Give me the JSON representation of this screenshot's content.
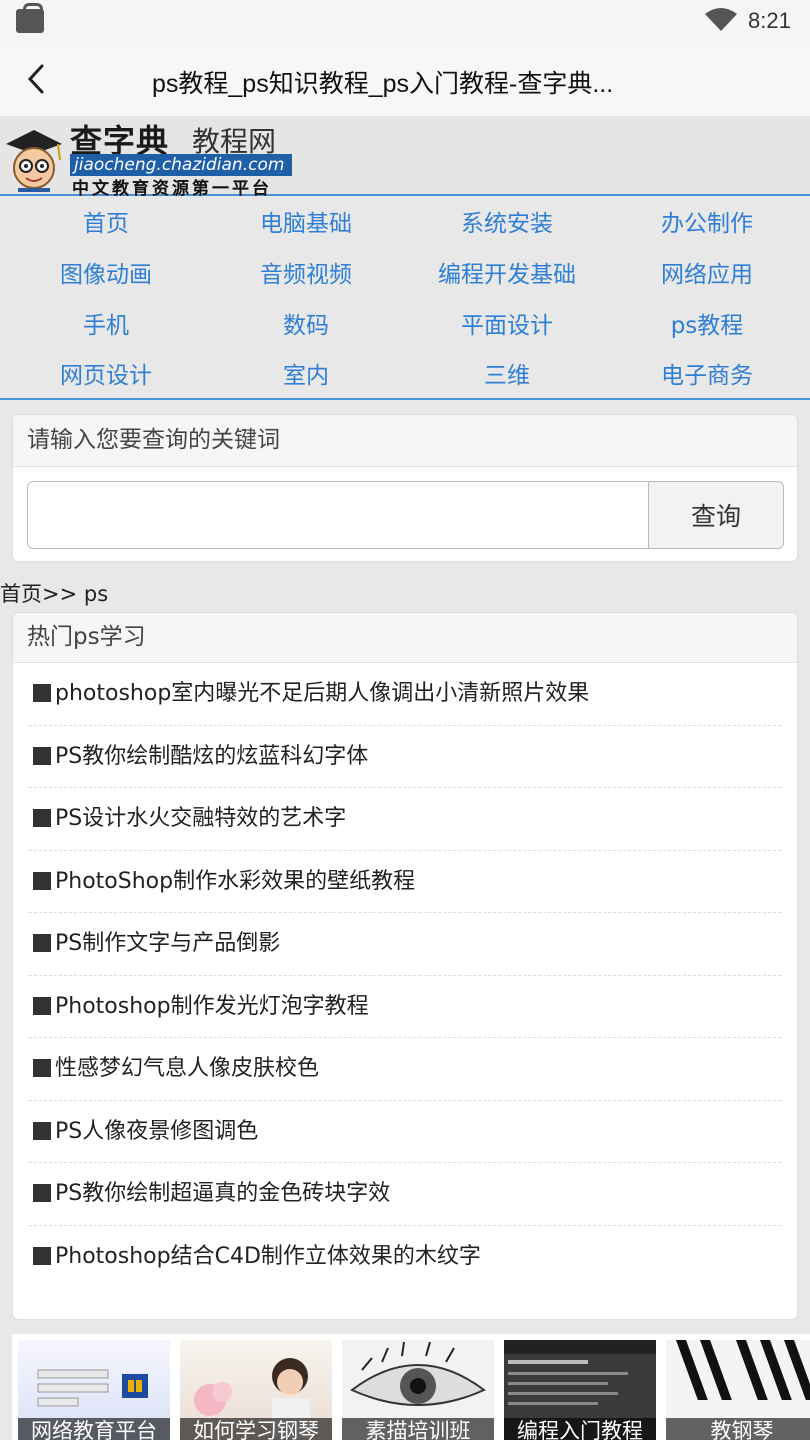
{
  "status_bar": {
    "time": "8:21"
  },
  "title_bar": {
    "title": "ps教程_ps知识教程_ps入门教程-查字典..."
  },
  "logo": {
    "brand": "查字典",
    "brand_sub": "教程网",
    "domain": "jiaocheng.chazidian.com",
    "slogan": "中文教育资源第一平台"
  },
  "nav": {
    "items": [
      {
        "label": "首页"
      },
      {
        "label": "电脑基础"
      },
      {
        "label": "系统安装"
      },
      {
        "label": "办公制作"
      },
      {
        "label": "图像动画"
      },
      {
        "label": "音频视频"
      },
      {
        "label": "编程开发基础"
      },
      {
        "label": "网络应用"
      },
      {
        "label": "手机"
      },
      {
        "label": "数码"
      },
      {
        "label": "平面设计"
      },
      {
        "label": "ps教程"
      },
      {
        "label": "网页设计"
      },
      {
        "label": "室内"
      },
      {
        "label": "三维"
      },
      {
        "label": "电子商务"
      }
    ]
  },
  "search": {
    "heading": "请输入您要查询的关键词",
    "value": "",
    "button_label": "查询"
  },
  "breadcrumb": "首页>> ps",
  "hot": {
    "heading": "热门ps学习",
    "items": [
      "photoshop室内曝光不足后期人像调出小清新照片效果",
      "PS教你绘制酷炫的炫蓝科幻字体",
      "PS设计水火交融特效的艺术字",
      "PhotoShop制作水彩效果的壁纸教程",
      "PS制作文字与产品倒影",
      "Photoshop制作发光灯泡字教程",
      "性感梦幻气息人像皮肤校色",
      "PS人像夜景修图调色",
      "PS教你绘制超逼真的金色砖块字效",
      "Photoshop结合C4D制作立体效果的木纹字"
    ]
  },
  "thumbs": [
    {
      "caption": "网络教育平台"
    },
    {
      "caption": "如何学习钢琴"
    },
    {
      "caption": "素描培训班"
    },
    {
      "caption": "编程入门教程"
    },
    {
      "caption": "教钢琴"
    }
  ],
  "colors": {
    "link": "#2f7fd6",
    "accent_line": "#4a90d9",
    "domain_bg": "#1e5fa8"
  }
}
